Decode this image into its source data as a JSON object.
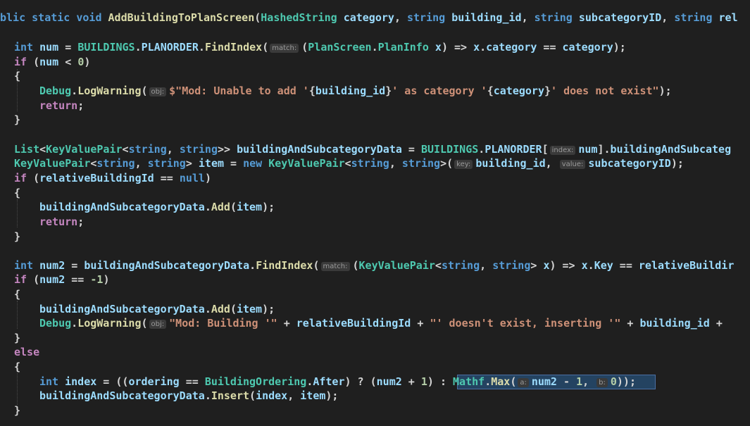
{
  "lines": [
    {
      "id": "L1",
      "tokens": [
        {
          "t": "blic static void ",
          "c": "kw"
        },
        {
          "t": "AddBuildingToPlanScreen",
          "c": "fn"
        },
        {
          "t": "(",
          "c": "pl"
        },
        {
          "t": "HashedString",
          "c": "ty"
        },
        {
          "t": " ",
          "c": "pl"
        },
        {
          "t": "category",
          "c": "var"
        },
        {
          "t": ", ",
          "c": "pl"
        },
        {
          "t": "string",
          "c": "kw"
        },
        {
          "t": " ",
          "c": "pl"
        },
        {
          "t": "building_id",
          "c": "var"
        },
        {
          "t": ", ",
          "c": "pl"
        },
        {
          "t": "string",
          "c": "kw"
        },
        {
          "t": " ",
          "c": "pl"
        },
        {
          "t": "subcategoryID",
          "c": "var"
        },
        {
          "t": ", ",
          "c": "pl"
        },
        {
          "t": "string",
          "c": "kw"
        },
        {
          "t": " rel",
          "c": "var"
        }
      ]
    },
    {
      "id": "L2",
      "tokens": [
        {
          "t": "int",
          "c": "kw"
        },
        {
          "t": " ",
          "c": "pl"
        },
        {
          "t": "num",
          "c": "var"
        },
        {
          "t": " = ",
          "c": "pl"
        },
        {
          "t": "BUILDINGS",
          "c": "ty"
        },
        {
          "t": ".",
          "c": "pl"
        },
        {
          "t": "PLANORDER",
          "c": "var"
        },
        {
          "t": ".",
          "c": "pl"
        },
        {
          "t": "FindIndex",
          "c": "fn"
        },
        {
          "t": "(",
          "c": "pl"
        },
        {
          "t": "match:",
          "c": "hint"
        },
        {
          "t": "(",
          "c": "pl"
        },
        {
          "t": "PlanScreen",
          "c": "ty"
        },
        {
          "t": ".",
          "c": "pl"
        },
        {
          "t": "PlanInfo",
          "c": "ty"
        },
        {
          "t": " ",
          "c": "pl"
        },
        {
          "t": "x",
          "c": "var"
        },
        {
          "t": ") => ",
          "c": "pl"
        },
        {
          "t": "x",
          "c": "var"
        },
        {
          "t": ".",
          "c": "pl"
        },
        {
          "t": "category",
          "c": "var"
        },
        {
          "t": " == ",
          "c": "pl"
        },
        {
          "t": "category",
          "c": "var"
        },
        {
          "t": ");",
          "c": "pl"
        }
      ]
    },
    {
      "id": "L3",
      "tokens": [
        {
          "t": "if",
          "c": "ctl"
        },
        {
          "t": " (",
          "c": "pl"
        },
        {
          "t": "num",
          "c": "var"
        },
        {
          "t": " < ",
          "c": "pl"
        },
        {
          "t": "0",
          "c": "num"
        },
        {
          "t": ")",
          "c": "pl"
        }
      ]
    },
    {
      "id": "L4",
      "tokens": [
        {
          "t": "{",
          "c": "pl"
        }
      ]
    },
    {
      "id": "L5",
      "tokens": [
        {
          "t": "Debug",
          "c": "ty"
        },
        {
          "t": ".",
          "c": "pl"
        },
        {
          "t": "LogWarning",
          "c": "fn"
        },
        {
          "t": "(",
          "c": "pl"
        },
        {
          "t": "obj:",
          "c": "hint"
        },
        {
          "t": "$\"Mod: Unable to add '",
          "c": "str"
        },
        {
          "t": "{",
          "c": "pl"
        },
        {
          "t": "building_id",
          "c": "var"
        },
        {
          "t": "}",
          "c": "pl"
        },
        {
          "t": "' as category '",
          "c": "str"
        },
        {
          "t": "{",
          "c": "pl"
        },
        {
          "t": "category",
          "c": "var"
        },
        {
          "t": "}",
          "c": "pl"
        },
        {
          "t": "' does not exist\"",
          "c": "str"
        },
        {
          "t": ");",
          "c": "pl"
        }
      ]
    },
    {
      "id": "L6",
      "tokens": [
        {
          "t": "return",
          "c": "ctl"
        },
        {
          "t": ";",
          "c": "pl"
        }
      ]
    },
    {
      "id": "L7",
      "tokens": [
        {
          "t": "}",
          "c": "pl"
        }
      ]
    },
    {
      "id": "L8",
      "tokens": [
        {
          "t": "List",
          "c": "ty"
        },
        {
          "t": "<",
          "c": "pl"
        },
        {
          "t": "KeyValuePair",
          "c": "ty"
        },
        {
          "t": "<",
          "c": "pl"
        },
        {
          "t": "string",
          "c": "kw"
        },
        {
          "t": ", ",
          "c": "pl"
        },
        {
          "t": "string",
          "c": "kw"
        },
        {
          "t": ">> ",
          "c": "pl"
        },
        {
          "t": "buildingAndSubcategoryData",
          "c": "var"
        },
        {
          "t": " = ",
          "c": "pl"
        },
        {
          "t": "BUILDINGS",
          "c": "ty"
        },
        {
          "t": ".",
          "c": "pl"
        },
        {
          "t": "PLANORDER",
          "c": "var"
        },
        {
          "t": "[",
          "c": "pl"
        },
        {
          "t": "index:",
          "c": "hint"
        },
        {
          "t": "num",
          "c": "var"
        },
        {
          "t": "].",
          "c": "pl"
        },
        {
          "t": "buildingAndSubcateg",
          "c": "var"
        }
      ]
    },
    {
      "id": "L9",
      "tokens": [
        {
          "t": "KeyValuePair",
          "c": "ty"
        },
        {
          "t": "<",
          "c": "pl"
        },
        {
          "t": "string",
          "c": "kw"
        },
        {
          "t": ", ",
          "c": "pl"
        },
        {
          "t": "string",
          "c": "kw"
        },
        {
          "t": "> ",
          "c": "pl"
        },
        {
          "t": "item",
          "c": "var"
        },
        {
          "t": " = ",
          "c": "pl"
        },
        {
          "t": "new",
          "c": "kw"
        },
        {
          "t": " ",
          "c": "pl"
        },
        {
          "t": "KeyValuePair",
          "c": "ty"
        },
        {
          "t": "<",
          "c": "pl"
        },
        {
          "t": "string",
          "c": "kw"
        },
        {
          "t": ", ",
          "c": "pl"
        },
        {
          "t": "string",
          "c": "kw"
        },
        {
          "t": ">(",
          "c": "pl"
        },
        {
          "t": "key:",
          "c": "hint"
        },
        {
          "t": "building_id",
          "c": "var"
        },
        {
          "t": ", ",
          "c": "pl"
        },
        {
          "t": "value:",
          "c": "hint"
        },
        {
          "t": "subcategoryID",
          "c": "var"
        },
        {
          "t": ");",
          "c": "pl"
        }
      ]
    },
    {
      "id": "L10",
      "tokens": [
        {
          "t": "if",
          "c": "ctl"
        },
        {
          "t": " (",
          "c": "pl"
        },
        {
          "t": "relativeBuildingId",
          "c": "var"
        },
        {
          "t": " == ",
          "c": "pl"
        },
        {
          "t": "null",
          "c": "kw"
        },
        {
          "t": ")",
          "c": "pl"
        }
      ]
    },
    {
      "id": "L11",
      "tokens": [
        {
          "t": "{",
          "c": "pl"
        }
      ]
    },
    {
      "id": "L12",
      "tokens": [
        {
          "t": "buildingAndSubcategoryData",
          "c": "var"
        },
        {
          "t": ".",
          "c": "pl"
        },
        {
          "t": "Add",
          "c": "fn"
        },
        {
          "t": "(",
          "c": "pl"
        },
        {
          "t": "item",
          "c": "var"
        },
        {
          "t": ");",
          "c": "pl"
        }
      ]
    },
    {
      "id": "L13",
      "tokens": [
        {
          "t": "return",
          "c": "ctl"
        },
        {
          "t": ";",
          "c": "pl"
        }
      ]
    },
    {
      "id": "L14",
      "tokens": [
        {
          "t": "}",
          "c": "pl"
        }
      ]
    },
    {
      "id": "L15",
      "tokens": [
        {
          "t": "int",
          "c": "kw"
        },
        {
          "t": " ",
          "c": "pl"
        },
        {
          "t": "num2",
          "c": "var"
        },
        {
          "t": " = ",
          "c": "pl"
        },
        {
          "t": "buildingAndSubcategoryData",
          "c": "var"
        },
        {
          "t": ".",
          "c": "pl"
        },
        {
          "t": "FindIndex",
          "c": "fn"
        },
        {
          "t": "(",
          "c": "pl"
        },
        {
          "t": "match:",
          "c": "hint"
        },
        {
          "t": "(",
          "c": "pl"
        },
        {
          "t": "KeyValuePair",
          "c": "ty"
        },
        {
          "t": "<",
          "c": "pl"
        },
        {
          "t": "string",
          "c": "kw"
        },
        {
          "t": ", ",
          "c": "pl"
        },
        {
          "t": "string",
          "c": "kw"
        },
        {
          "t": "> ",
          "c": "pl"
        },
        {
          "t": "x",
          "c": "var"
        },
        {
          "t": ") => ",
          "c": "pl"
        },
        {
          "t": "x",
          "c": "var"
        },
        {
          "t": ".",
          "c": "pl"
        },
        {
          "t": "Key",
          "c": "var"
        },
        {
          "t": " == ",
          "c": "pl"
        },
        {
          "t": "relativeBuildir",
          "c": "var"
        }
      ]
    },
    {
      "id": "L16",
      "tokens": [
        {
          "t": "if",
          "c": "ctl"
        },
        {
          "t": " (",
          "c": "pl"
        },
        {
          "t": "num2",
          "c": "var"
        },
        {
          "t": " == ",
          "c": "pl"
        },
        {
          "t": "-1",
          "c": "num"
        },
        {
          "t": ")",
          "c": "pl"
        }
      ]
    },
    {
      "id": "L17",
      "tokens": [
        {
          "t": "{",
          "c": "pl"
        }
      ]
    },
    {
      "id": "L18",
      "tokens": [
        {
          "t": "buildingAndSubcategoryData",
          "c": "var"
        },
        {
          "t": ".",
          "c": "pl"
        },
        {
          "t": "Add",
          "c": "fn"
        },
        {
          "t": "(",
          "c": "pl"
        },
        {
          "t": "item",
          "c": "var"
        },
        {
          "t": ");",
          "c": "pl"
        }
      ]
    },
    {
      "id": "L19",
      "tokens": [
        {
          "t": "Debug",
          "c": "ty"
        },
        {
          "t": ".",
          "c": "pl"
        },
        {
          "t": "LogWarning",
          "c": "fn"
        },
        {
          "t": "(",
          "c": "pl"
        },
        {
          "t": "obj:",
          "c": "hint"
        },
        {
          "t": "\"Mod: Building '\"",
          "c": "str"
        },
        {
          "t": " + ",
          "c": "pl"
        },
        {
          "t": "relativeBuildingId",
          "c": "var"
        },
        {
          "t": " + ",
          "c": "pl"
        },
        {
          "t": "\"' doesn't exist, inserting '\"",
          "c": "str"
        },
        {
          "t": " + ",
          "c": "pl"
        },
        {
          "t": "building_id",
          "c": "var"
        },
        {
          "t": " +",
          "c": "pl"
        }
      ]
    },
    {
      "id": "L20",
      "tokens": [
        {
          "t": "}",
          "c": "pl"
        }
      ]
    },
    {
      "id": "L21",
      "tokens": [
        {
          "t": "else",
          "c": "ctl"
        }
      ]
    },
    {
      "id": "L22",
      "tokens": [
        {
          "t": "{",
          "c": "pl"
        }
      ]
    },
    {
      "id": "L23",
      "tokens": [
        {
          "t": "int",
          "c": "kw"
        },
        {
          "t": " ",
          "c": "pl"
        },
        {
          "t": "index",
          "c": "var"
        },
        {
          "t": " = ((",
          "c": "pl"
        },
        {
          "t": "ordering",
          "c": "var"
        },
        {
          "t": " == ",
          "c": "pl"
        },
        {
          "t": "BuildingOrdering",
          "c": "ty"
        },
        {
          "t": ".",
          "c": "pl"
        },
        {
          "t": "After",
          "c": "var"
        },
        {
          "t": ") ? (",
          "c": "pl"
        },
        {
          "t": "num2",
          "c": "var"
        },
        {
          "t": " + ",
          "c": "pl"
        },
        {
          "t": "1",
          "c": "num"
        },
        {
          "t": ") : ",
          "c": "pl"
        },
        {
          "t": "Mathf",
          "c": "ty"
        },
        {
          "t": ".",
          "c": "pl"
        },
        {
          "t": "Max",
          "c": "fn"
        },
        {
          "t": "(",
          "c": "pl"
        },
        {
          "t": "a:",
          "c": "hint"
        },
        {
          "t": "num2",
          "c": "var"
        },
        {
          "t": " - ",
          "c": "pl"
        },
        {
          "t": "1",
          "c": "num"
        },
        {
          "t": ", ",
          "c": "pl"
        },
        {
          "t": "b:",
          "c": "hint"
        },
        {
          "t": "0",
          "c": "num"
        },
        {
          "t": "));",
          "c": "pl"
        }
      ]
    },
    {
      "id": "L24",
      "tokens": [
        {
          "t": "buildingAndSubcategoryData",
          "c": "var"
        },
        {
          "t": ".",
          "c": "pl"
        },
        {
          "t": "Insert",
          "c": "fn"
        },
        {
          "t": "(",
          "c": "pl"
        },
        {
          "t": "index",
          "c": "var"
        },
        {
          "t": ", ",
          "c": "pl"
        },
        {
          "t": "item",
          "c": "var"
        },
        {
          "t": ");",
          "c": "pl"
        }
      ]
    },
    {
      "id": "L25",
      "tokens": [
        {
          "t": "}",
          "c": "pl"
        }
      ]
    }
  ]
}
